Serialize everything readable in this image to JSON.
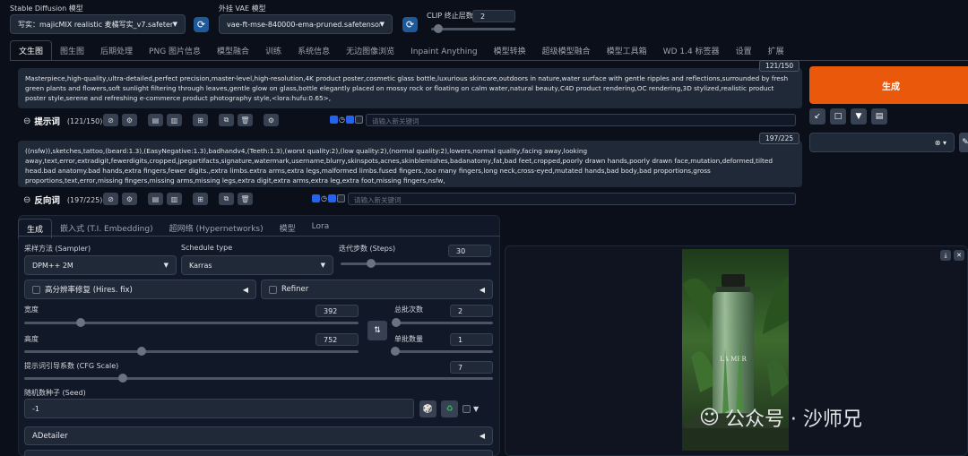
{
  "top": {
    "sd_model_label": "Stable Diffusion 模型",
    "sd_model_value": "写实：majicMIX realistic 麦橘写实_v7.safetens",
    "vae_label": "外挂 VAE 模型",
    "vae_value": "vae-ft-mse-840000-ema-pruned.safetensors",
    "clip_label": "CLIP 终止层数",
    "clip_value": "2",
    "clip_level": 0.08
  },
  "tabs": [
    "文生图",
    "图生图",
    "后期处理",
    "PNG 图片信息",
    "模型融合",
    "训练",
    "系统信息",
    "无边图像浏览",
    "Inpaint Anything",
    "模型转换",
    "超级模型融合",
    "模型工具箱",
    "WD 1.4 标签器",
    "设置",
    "扩展"
  ],
  "prompt": {
    "text": "Masterpiece,high-quality,ultra-detailed,perfect precision,master-level,high-resolution,4K product poster,cosmetic glass bottle,luxurious skincare,outdoors in nature,water surface with gentle ripples and reflections,surrounded by fresh green plants and flowers,soft sunlight filtering through leaves,gentle glow on glass,bottle elegantly placed on mossy rock or floating on calm water,natural beauty,C4D product rendering,OC rendering,3D stylized,realistic product poster style,serene and refreshing e-commerce product photography style,<lora:hufu:0.65>,",
    "counter": "121/150",
    "label": "提示词",
    "label_count": "(121/150)",
    "kw_placeholder": "请输入新关键词"
  },
  "negative": {
    "text": "((nsfw)),sketches,tattoo,(beard:1.3),(EasyNegative:1.3),badhandv4,(Teeth:1.3),(worst quality:2),(low quality:2),(normal quality:2),lowers,normal quality,facing away,looking away,text,error,extradigit,fewerdigits,cropped,jpegartifacts,signature,watermark,username,blurry,skinspots,acnes,skinblemishes,badanatomy,fat,bad feet,cropped,poorly drawn hands,poorly drawn face,mutation,deformed,tilted head.bad anatomy.bad hands,extra fingers,fewer digits.,extra limbs.extra arms,extra legs,malformed limbs.fused fingers.,too many fingers,long neck,cross-eyed,mutated hands,bad body,bad proportions,gross proportions,text,error,missing fingers,missing arms,missing legs,extra digit,extra arms,extra leg,extra foot,missing fingers,nsfw,",
    "counter": "197/225",
    "label": "反向词",
    "label_count": "(197/225)",
    "kw_placeholder": "请输入新关键词"
  },
  "generate_label": "生成",
  "subtabs": [
    "生成",
    "嵌入式 (T.I. Embedding)",
    "超网络 (Hypernetworks)",
    "模型",
    "Lora"
  ],
  "params": {
    "sampler_label": "采样方法 (Sampler)",
    "sampler_value": "DPM++ 2M",
    "schedule_label": "Schedule type",
    "schedule_value": "Karras",
    "steps_label": "迭代步数 (Steps)",
    "steps_value": "30",
    "steps_level": 0.2,
    "hires_label": "高分辨率修复 (Hires. fix)",
    "refiner_label": "Refiner",
    "width_label": "宽度",
    "width_value": "392",
    "width_level": 0.17,
    "height_label": "高度",
    "height_value": "752",
    "height_level": 0.35,
    "batch_count_label": "总批次数",
    "batch_count_value": "2",
    "batch_count_level": 0.01,
    "batch_size_label": "单批数量",
    "batch_size_value": "1",
    "batch_size_level": 0.0,
    "cfg_label": "提示词引导系数 (CFG Scale)",
    "cfg_value": "7",
    "cfg_level": 0.21,
    "seed_label": "随机数种子 (Seed)",
    "seed_value": "-1",
    "adetailer_label": "ADetailer"
  },
  "image": {
    "bottle_text": "LA MER"
  },
  "watermark": "公众号 · 沙师兄",
  "colors": {
    "generate": "#ea580c",
    "accent": "#2563eb"
  }
}
